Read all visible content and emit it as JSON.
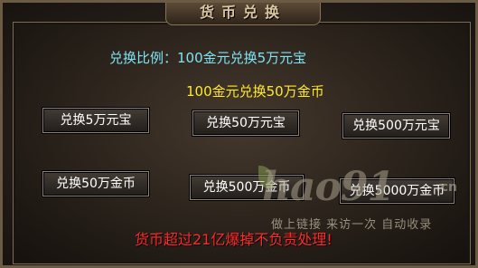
{
  "window": {
    "title": "货币兑换"
  },
  "info": {
    "ratio_text": "兑换比例：100金元兑换5万元宝",
    "gold_text": "100金元兑换50万金币"
  },
  "buttons": {
    "yuanbao_5w": "兑换5万元宝",
    "yuanbao_50w": "兑换50万元宝",
    "yuanbao_500w": "兑换500万元宝",
    "gold_50w": "兑换50万金币",
    "gold_500w": "兑换500万金币",
    "gold_5000w": "兑换5000万金币"
  },
  "warning": "货币超过21亿爆掉不负责处理!",
  "watermark": {
    "logo": "hao91",
    "domain": ".cn",
    "slogan": "做上链接 来访一次 自动收录"
  },
  "colors": {
    "ratio": "#7fe3f3",
    "gold": "#ffe82a",
    "warning": "#ff2a2a"
  }
}
